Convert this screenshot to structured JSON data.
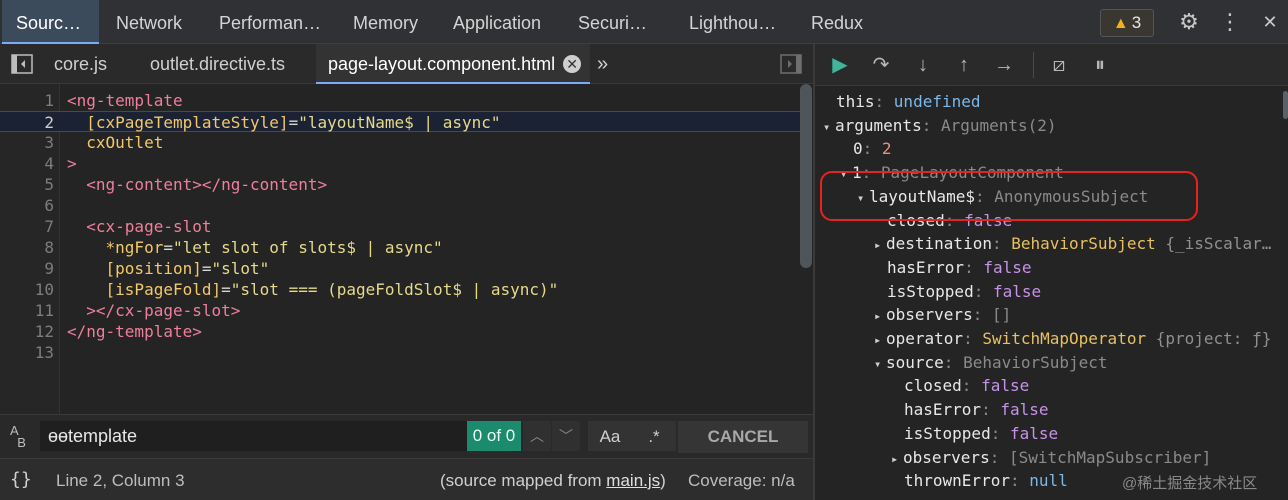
{
  "top_tabs": [
    {
      "label": "Sourc…",
      "active": true
    },
    {
      "label": "Network"
    },
    {
      "label": "Performan…"
    },
    {
      "label": "Memory"
    },
    {
      "label": "Application"
    },
    {
      "label": "Securi…"
    },
    {
      "label": "Lighthou…"
    },
    {
      "label": "Redux"
    }
  ],
  "warnings": {
    "count": "3",
    "icon": "warning-triangle-icon",
    "glyph": "▲"
  },
  "top_icons": {
    "settings_glyph": "⚙",
    "more_glyph": "⋮",
    "close_glyph": "✕"
  },
  "file_tabs": [
    {
      "label": "core.js"
    },
    {
      "label": "outlet.directive.ts"
    },
    {
      "label": "page-layout.component.html",
      "active": true,
      "close": "✕"
    }
  ],
  "more_tabs_glyph": "»",
  "editor": {
    "current_line": 2,
    "lines": [
      {
        "n": "1",
        "code": "<ng-template"
      },
      {
        "n": "2",
        "code": "  [cxPageTemplateStyle]=\"layoutName$ | async\""
      },
      {
        "n": "3",
        "code": "  cxOutlet"
      },
      {
        "n": "4",
        "code": ">"
      },
      {
        "n": "5",
        "code": "  <ng-content></ng-content>"
      },
      {
        "n": "6",
        "code": ""
      },
      {
        "n": "7",
        "code": "  <cx-page-slot"
      },
      {
        "n": "8",
        "code": "    *ngFor=\"let slot of slots$ | async\""
      },
      {
        "n": "9",
        "code": "    [position]=\"slot\""
      },
      {
        "n": "10",
        "code": "    [isPageFold]=\"slot === (pageFoldSlot$ | async)\""
      },
      {
        "n": "11",
        "code": "  ></cx-page-slot>"
      },
      {
        "n": "12",
        "code": "</ng-template>"
      },
      {
        "n": "13",
        "code": ""
      }
    ]
  },
  "search": {
    "value": "ɵɵtemplate",
    "match_count": "0 of 0",
    "up_glyph": "︿",
    "down_glyph": "﹀",
    "case_label": "Aa",
    "regex_label": ".*",
    "cancel_label": "CANCEL"
  },
  "status": {
    "braces": "{}",
    "position": "Line 2, Column 3",
    "mapped_prefix": "(source mapped from ",
    "mapped_link": "main.js",
    "mapped_suffix": ")",
    "coverage": "Coverage: n/a"
  },
  "debugger_buttons": [
    {
      "name": "resume-button",
      "glyph": "▶"
    },
    {
      "name": "step-over-button",
      "glyph": "↷"
    },
    {
      "name": "step-into-button",
      "glyph": "↓"
    },
    {
      "name": "step-out-button",
      "glyph": "↑"
    },
    {
      "name": "step-button",
      "glyph": "→"
    },
    {
      "name": "deactivate-breakpoints-button",
      "glyph": "⧄"
    },
    {
      "name": "pause-on-exceptions-button",
      "glyph": "⏸"
    }
  ],
  "scope": [
    {
      "indent": 0,
      "toggle": "",
      "key": "this",
      "value": "undefined",
      "vclass": "v-undef"
    },
    {
      "indent": 0,
      "toggle": "▾",
      "key": "arguments",
      "value": "Arguments(2)",
      "vclass": "v-dim"
    },
    {
      "indent": 1,
      "toggle": "",
      "key": "0",
      "value": "2",
      "vclass": "v-num"
    },
    {
      "indent": 1,
      "toggle": "▾",
      "key": "1",
      "value": "PageLayoutComponent",
      "vclass": "v-dim",
      "kclass": "key"
    },
    {
      "indent": 2,
      "toggle": "▾",
      "key": "layoutName$",
      "value": "AnonymousSubject",
      "vclass": "v-dim"
    },
    {
      "indent": 3,
      "toggle": "",
      "key": "closed",
      "value": "false",
      "vclass": "v-bool"
    },
    {
      "indent": 3,
      "toggle": "▸",
      "key": "destination",
      "value": "BehaviorSubject",
      "vclass": "v-obj",
      "extra": "{_isScalar…"
    },
    {
      "indent": 3,
      "toggle": "",
      "key": "hasError",
      "value": "false",
      "vclass": "v-bool"
    },
    {
      "indent": 3,
      "toggle": "",
      "key": "isStopped",
      "value": "false",
      "vclass": "v-bool"
    },
    {
      "indent": 3,
      "toggle": "▸",
      "key": "observers",
      "value": "[]",
      "vclass": "v-dim"
    },
    {
      "indent": 3,
      "toggle": "▸",
      "key": "operator",
      "value": "SwitchMapOperator",
      "vclass": "v-obj",
      "extra": "{project: ƒ}"
    },
    {
      "indent": 3,
      "toggle": "▾",
      "key": "source",
      "value": "BehaviorSubject",
      "vclass": "v-dim"
    },
    {
      "indent": 4,
      "toggle": "",
      "key": "closed",
      "value": "false",
      "vclass": "v-bool"
    },
    {
      "indent": 4,
      "toggle": "",
      "key": "hasError",
      "value": "false",
      "vclass": "v-bool"
    },
    {
      "indent": 4,
      "toggle": "",
      "key": "isStopped",
      "value": "false",
      "vclass": "v-bool"
    },
    {
      "indent": 4,
      "toggle": "▸",
      "key": "observers",
      "value": "[SwitchMapSubscriber]",
      "vclass": "v-dim"
    },
    {
      "indent": 4,
      "toggle": "",
      "key": "thrownError",
      "value": "null",
      "vclass": "v-undef"
    }
  ],
  "watermark": "@稀土掘金技术社区",
  "colors": {
    "accent": "#7cacf8",
    "highlight": "#e8231e",
    "match": "#1b8a6d"
  }
}
